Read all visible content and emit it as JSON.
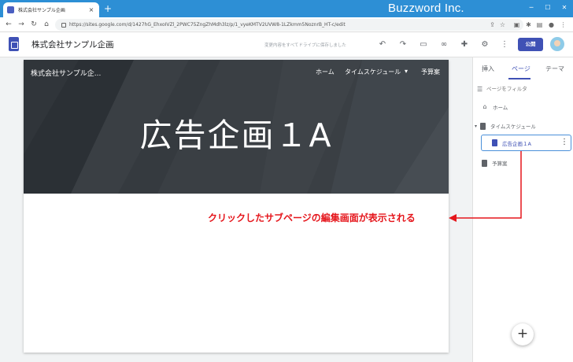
{
  "browser": {
    "tab_title": "株式会社サンプル企画",
    "tab_close": "×",
    "new_tab": "+",
    "brand": "Buzzword Inc.",
    "url": "https://sites.google.com/d/1427hG_EhxoIVZl_2PWC75ZngZhMdh3lz/p/1_vyeKMTV2UVW8-1LZkmm5NoznrB_HT-c/edit"
  },
  "header": {
    "site_name": "株式会社サンプル企画",
    "save_status": "変更内容をすべてドライブに保存しました",
    "publish_label": "公開"
  },
  "hero": {
    "site_name": "株式会社サンプル企...",
    "nav": [
      "ホーム",
      "タイムスケジュール",
      "予算案"
    ],
    "title": "広告企画１A"
  },
  "panel": {
    "tabs": [
      "挿入",
      "ページ",
      "テーマ"
    ],
    "active_tab": "ページ",
    "filter_placeholder": "ページをフィルタ",
    "pages": [
      {
        "label": "ホーム"
      },
      {
        "label": "タイムスケジュール"
      },
      {
        "label": "広告企画１A",
        "selected": true
      },
      {
        "label": "予算案"
      }
    ]
  },
  "annotation": {
    "text": "クリックしたサブページの編集画面が表示される",
    "color": "#e5161c"
  },
  "colors": {
    "accent": "#3f51b5",
    "browser_chrome": "#2d8fd5",
    "hero_bg": "#3a3f44"
  }
}
